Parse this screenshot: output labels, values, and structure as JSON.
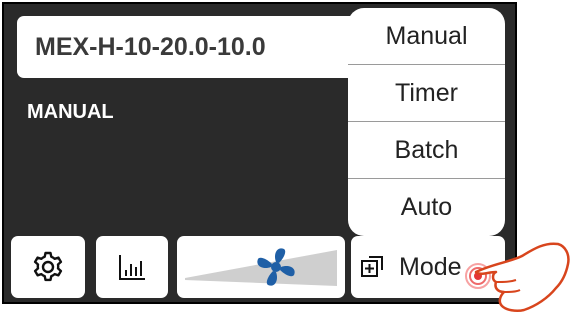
{
  "device": {
    "name": "MEX-H-10-20.0-10.0"
  },
  "status": {
    "mode": "MANUAL"
  },
  "mode_menu": {
    "items": [
      "Manual",
      "Timer",
      "Batch",
      "Auto"
    ]
  },
  "toolbar": {
    "settings_icon": "gear-icon",
    "chart_icon": "bar-chart-icon",
    "fan_icon": "fan-icon",
    "fan_speed": 0.6,
    "mode_icon": "mode-switch-icon",
    "mode_label": "Mode"
  },
  "colors": {
    "background": "#2a2a2a",
    "fan": "#1f5fa6",
    "panel": "#ffffff"
  }
}
